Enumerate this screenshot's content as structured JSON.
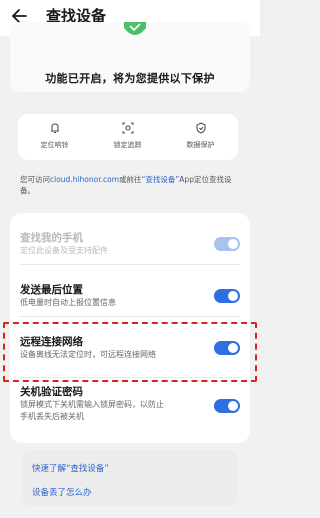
{
  "header": {
    "title": "查找设备"
  },
  "hero": {
    "status_text": "功能已开启，将为您提供以下保护"
  },
  "features": [
    {
      "label": "定位响铃"
    },
    {
      "label": "锁定追踪"
    },
    {
      "label": "数据保护"
    }
  ],
  "note": {
    "prefix": "您可访问",
    "link1": "cloud.hihonor.com",
    "middle": "或前往",
    "link2": "“查找设备”",
    "suffix": "App定位查找设备。"
  },
  "settings": [
    {
      "title": "查找我的手机",
      "subtitle": "定位此设备及受支持配件",
      "enabled": true,
      "disabled": true
    },
    {
      "title": "发送最后位置",
      "subtitle": "低电量时自动上报位置信息",
      "enabled": true,
      "disabled": false
    },
    {
      "title": "远程连接网络",
      "subtitle": "设备离线无法定位时，可远程连接网络",
      "enabled": true,
      "disabled": false
    },
    {
      "title": "关机验证密码",
      "subtitle_line1": "锁屏模式下关机需输入锁屏密码，以防止",
      "subtitle_line2": "手机丢失后被关机",
      "enabled": true,
      "disabled": false
    }
  ],
  "links": {
    "learn_more": "快速了解“查找设备”",
    "lost_device": "设备丢了怎么办"
  },
  "colors": {
    "accent": "#2f6fdf",
    "link": "#2a62cc",
    "highlight_border": "#d9231b"
  }
}
